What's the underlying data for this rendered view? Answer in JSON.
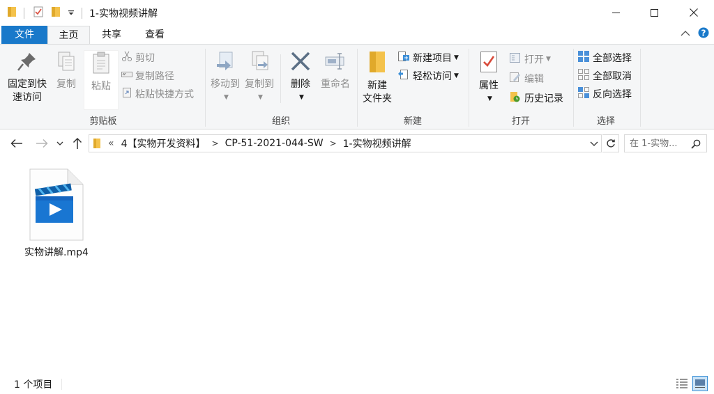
{
  "window": {
    "title": "1-实物视频讲解",
    "controls": {
      "minimize": "minimize",
      "maximize": "maximize",
      "close": "close"
    }
  },
  "ribbon_tabs": {
    "file": "文件",
    "home": "主页",
    "share": "共享",
    "view": "查看"
  },
  "ribbon": {
    "clipboard": {
      "label": "剪贴板",
      "pin_line1": "固定到快",
      "pin_line2": "速访问",
      "copy": "复制",
      "paste": "粘贴",
      "cut": "剪切",
      "copy_path": "复制路径",
      "paste_shortcut": "粘贴快捷方式"
    },
    "organize": {
      "label": "组织",
      "move_to": "移动到",
      "copy_to": "复制到",
      "delete": "删除",
      "rename": "重命名"
    },
    "new": {
      "label": "新建",
      "new_folder_line1": "新建",
      "new_folder_line2": "文件夹",
      "new_item": "新建项目",
      "easy_access": "轻松访问"
    },
    "open": {
      "label": "打开",
      "properties": "属性",
      "open": "打开",
      "edit": "编辑",
      "history": "历史记录"
    },
    "select": {
      "label": "选择",
      "select_all": "全部选择",
      "select_none": "全部取消",
      "invert": "反向选择"
    }
  },
  "address": {
    "overflow": "«",
    "crumbs": [
      "4【实物开发资料】",
      "CP-51-2021-044-SW",
      "1-实物视频讲解"
    ],
    "search_placeholder": "在 1-实物..."
  },
  "files": [
    {
      "name": "实物讲解.mp4",
      "icon": "video-file-icon"
    }
  ],
  "status": {
    "count": "1 个项目"
  },
  "colors": {
    "accent": "#1979ca",
    "folder": "#f4c24b",
    "video_blue": "#1976d2"
  }
}
